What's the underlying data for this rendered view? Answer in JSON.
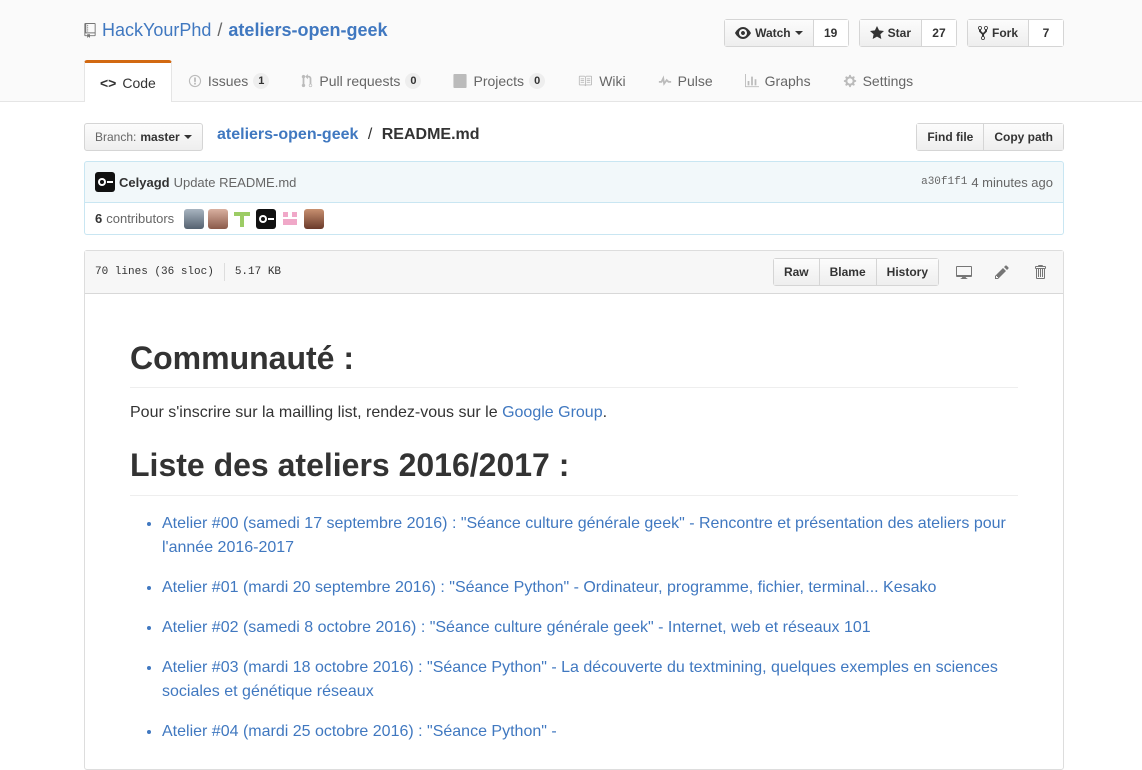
{
  "repo": {
    "owner": "HackYourPhd",
    "separator": "/",
    "name": "ateliers-open-geek"
  },
  "actions": {
    "watch": {
      "label": "Watch",
      "count": "19"
    },
    "star": {
      "label": "Star",
      "count": "27"
    },
    "fork": {
      "label": "Fork",
      "count": "7"
    }
  },
  "nav": [
    {
      "label": "Code",
      "icon": "code-icon"
    },
    {
      "label": "Issues",
      "count": "1",
      "icon": "issue-icon"
    },
    {
      "label": "Pull requests",
      "count": "0",
      "icon": "pull-request-icon"
    },
    {
      "label": "Projects",
      "count": "0",
      "icon": "project-icon"
    },
    {
      "label": "Wiki",
      "icon": "book-icon"
    },
    {
      "label": "Pulse",
      "icon": "pulse-icon"
    },
    {
      "label": "Graphs",
      "icon": "graph-icon"
    },
    {
      "label": "Settings",
      "icon": "gear-icon"
    }
  ],
  "file_nav": {
    "branch_prefix": "Branch:",
    "branch": "master",
    "crumb_repo": "ateliers-open-geek",
    "crumb_sep": "/",
    "crumb_file": "README.md",
    "find_file": "Find file",
    "copy_path": "Copy path"
  },
  "commit": {
    "author": "Celyagd",
    "message": "Update README.md",
    "sha": "a30f1f1",
    "time": "4 minutes ago"
  },
  "contributors": {
    "count": "6",
    "label": "contributors"
  },
  "file": {
    "lines": "70 lines (36 sloc)",
    "size": "5.17 KB",
    "raw": "Raw",
    "blame": "Blame",
    "history": "History"
  },
  "readme": {
    "h1_community": "Communauté :",
    "p_prefix": "Pour s'inscrire sur la mailling list, rendez-vous sur le ",
    "p_link": "Google Group",
    "p_suffix": ".",
    "h1_list": "Liste des ateliers 2016/2017 :",
    "ateliers": [
      "Atelier #00 (samedi 17 septembre 2016) : \"Séance culture générale geek\" - Rencontre et présentation des ateliers pour l'année 2016-2017",
      "Atelier #01 (mardi 20 septembre 2016) : \"Séance Python\" - Ordinateur, programme, fichier, terminal... Kesako",
      "Atelier #02 (samedi 8 octobre 2016) : \"Séance culture générale geek\" - Internet, web et réseaux 101",
      "Atelier #03 (mardi 18 octobre 2016) : \"Séance Python\" - La découverte du textmining, quelques exemples en sciences sociales et génétique réseaux",
      "Atelier #04 (mardi 25 octobre 2016) : \"Séance Python\" -"
    ]
  },
  "colors": {
    "link": "#4078c0",
    "selected_tab_border": "#d26911",
    "commit_bg": "#f2f8fa",
    "commit_border": "#c9e6f2"
  }
}
